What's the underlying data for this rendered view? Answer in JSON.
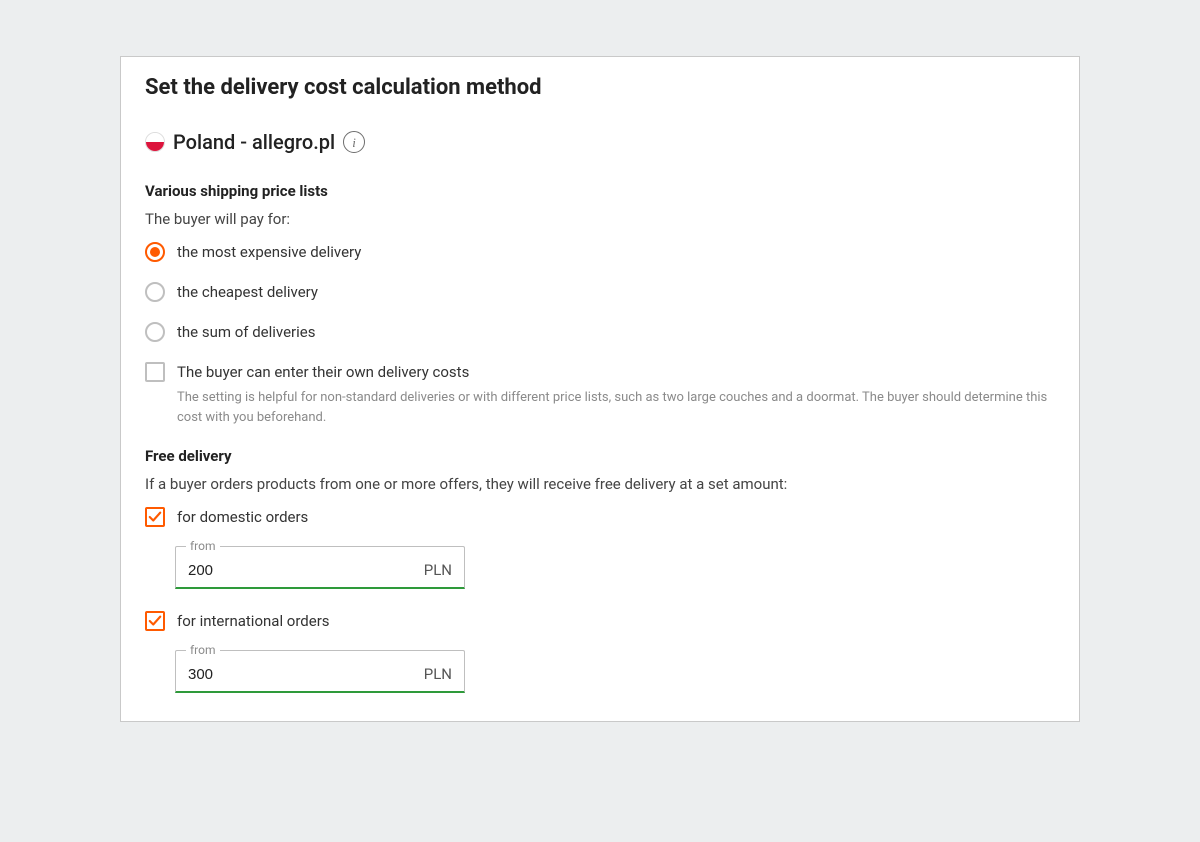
{
  "page": {
    "title": "Set the delivery cost calculation method"
  },
  "market": {
    "name": "Poland - allegro.pl",
    "flag": "pl"
  },
  "shipping_lists": {
    "heading": "Various shipping price lists",
    "intro": "The buyer will pay for:",
    "options": [
      {
        "id": "most_expensive",
        "label": "the most expensive delivery",
        "selected": true
      },
      {
        "id": "cheapest",
        "label": "the cheapest delivery",
        "selected": false
      },
      {
        "id": "sum",
        "label": "the sum of deliveries",
        "selected": false
      }
    ],
    "custom_cost": {
      "checked": false,
      "label": "The buyer can enter their own delivery costs",
      "description": "The setting is helpful for non-standard deliveries or with different price lists, such as two large couches and a doormat. The buyer should determine this cost with you beforehand."
    }
  },
  "free_delivery": {
    "heading": "Free delivery",
    "intro": "If a buyer orders products from one or more offers, they will receive free delivery at a set amount:",
    "field_legend": "from",
    "currency": "PLN",
    "domestic": {
      "checked": true,
      "label": "for domestic orders",
      "value": "200"
    },
    "international": {
      "checked": true,
      "label": "for international orders",
      "value": "300"
    }
  }
}
